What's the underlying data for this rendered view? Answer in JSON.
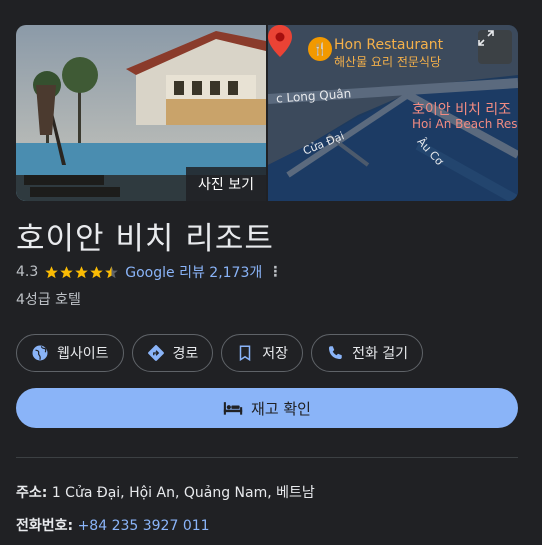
{
  "photo": {
    "button_label": "사진 보기"
  },
  "map": {
    "poi1_title": "Hon Restaurant",
    "poi1_subtitle": "해산물 요리 전문식당",
    "street1": "c Long Quân",
    "street2": "Cửa Đại",
    "street3": "Âu Cơ",
    "poi2_title": "호이안 비치 리조",
    "poi2_subtitle": "Hoi An Beach Resor",
    "expand_icon": "expand-icon"
  },
  "title": "호이안 비치 리조트",
  "rating": {
    "value": "4.3",
    "stars": 4.3,
    "reviews_label": "Google 리뷰 2,173개",
    "more": "⋮"
  },
  "category": "4성급 호텔",
  "actions": [
    {
      "label": "웹사이트",
      "icon": "globe-icon"
    },
    {
      "label": "경로",
      "icon": "directions-icon"
    },
    {
      "label": "저장",
      "icon": "bookmark-icon"
    },
    {
      "label": "전화 걸기",
      "icon": "phone-icon"
    }
  ],
  "primary": {
    "label": "재고 확인",
    "icon": "bed-icon"
  },
  "address": {
    "label": "주소:",
    "value": "1 Cửa Đại, Hội An, Quảng Nam, 베트남"
  },
  "phone": {
    "label": "전화번호:",
    "value": "+84 235 3927 011"
  },
  "colors": {
    "background": "#202124",
    "accent": "#8ab4f8",
    "star": "#fbbc04",
    "map_water": "#1e3a5c"
  }
}
